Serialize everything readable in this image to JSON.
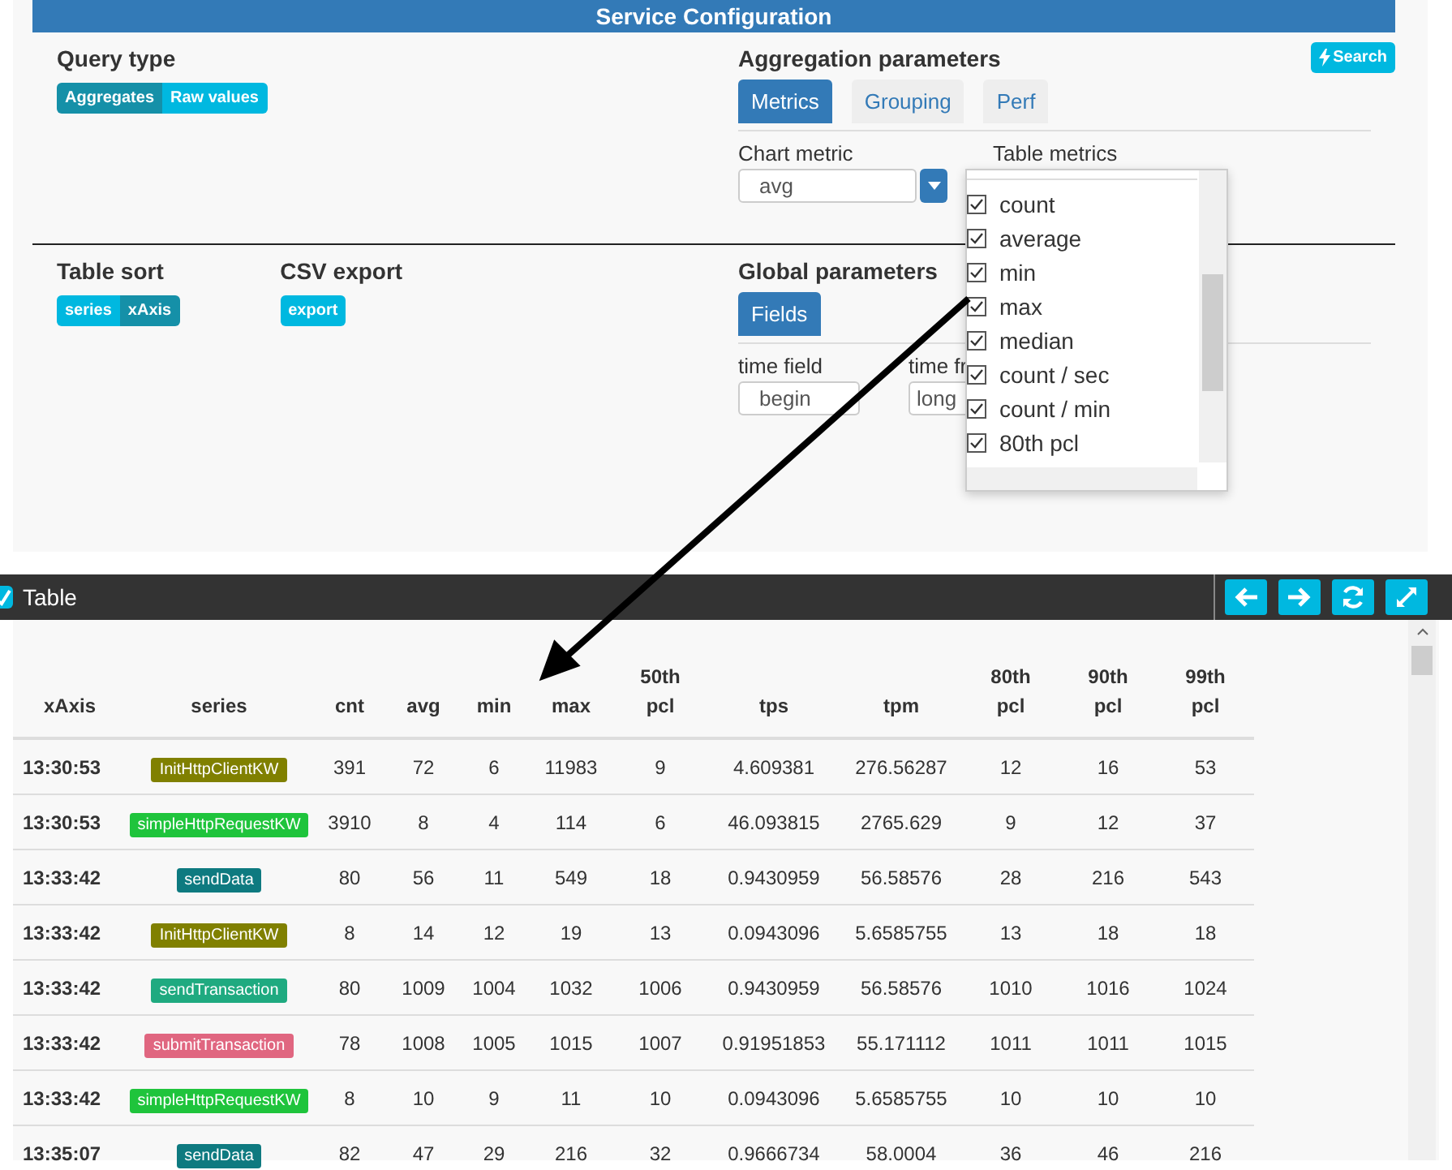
{
  "config": {
    "title": "Service Configuration",
    "query_type": {
      "label": "Query type",
      "options": [
        {
          "label": "Aggregates",
          "selected": true
        },
        {
          "label": "Raw values",
          "selected": false
        }
      ]
    },
    "aggregation": {
      "label": "Aggregation parameters",
      "search_button": "Search",
      "tabs": [
        {
          "label": "Metrics",
          "selected": true
        },
        {
          "label": "Grouping",
          "selected": false
        },
        {
          "label": "Perf",
          "selected": false
        }
      ],
      "chart_metric": {
        "label": "Chart metric",
        "value": "avg"
      },
      "table_metrics": {
        "label": "Table metrics",
        "options": [
          {
            "label": "count",
            "checked": true
          },
          {
            "label": "average",
            "checked": true
          },
          {
            "label": "min",
            "checked": true
          },
          {
            "label": "max",
            "checked": true
          },
          {
            "label": "median",
            "checked": true
          },
          {
            "label": "count / sec",
            "checked": true
          },
          {
            "label": "count / min",
            "checked": true
          },
          {
            "label": "80th pcl",
            "checked": true
          }
        ]
      }
    },
    "table_sort": {
      "label": "Table sort",
      "options": [
        {
          "label": "series",
          "selected": false
        },
        {
          "label": "xAxis",
          "selected": true
        }
      ]
    },
    "csv_export": {
      "label": "CSV export",
      "button": "export"
    },
    "global": {
      "label": "Global parameters",
      "tabs": [
        {
          "label": "Fields",
          "selected": true
        }
      ],
      "fields": [
        {
          "label": "time field",
          "value": "begin"
        },
        {
          "label": "time fr",
          "value": "long"
        }
      ]
    }
  },
  "table_panel": {
    "title": "Table",
    "columns": [
      "xAxis",
      "series",
      "cnt",
      "avg",
      "min",
      "max",
      "50th pcl",
      "tps",
      "tpm",
      "80th pcl",
      "90th pcl",
      "99th pcl"
    ],
    "rows": [
      {
        "xAxis": "13:30:53",
        "series": "InitHttpClientKW",
        "color": "#808000",
        "values": [
          "391",
          "72",
          "6",
          "11983",
          "9",
          "4.609381",
          "276.56287",
          "12",
          "16",
          "53"
        ]
      },
      {
        "xAxis": "13:30:53",
        "series": "simpleHttpRequestKW",
        "color": "#1fc43c",
        "values": [
          "3910",
          "8",
          "4",
          "114",
          "6",
          "46.093815",
          "2765.629",
          "9",
          "12",
          "37"
        ]
      },
      {
        "xAxis": "13:33:42",
        "series": "sendData",
        "color": "#0e7a80",
        "values": [
          "80",
          "56",
          "11",
          "549",
          "18",
          "0.9430959",
          "56.58576",
          "28",
          "216",
          "543"
        ]
      },
      {
        "xAxis": "13:33:42",
        "series": "InitHttpClientKW",
        "color": "#808000",
        "values": [
          "8",
          "14",
          "12",
          "19",
          "13",
          "0.0943096",
          "5.6585755",
          "13",
          "18",
          "18"
        ]
      },
      {
        "xAxis": "13:33:42",
        "series": "sendTransaction",
        "color": "#1faa80",
        "values": [
          "80",
          "1009",
          "1004",
          "1032",
          "1006",
          "0.9430959",
          "56.58576",
          "1010",
          "1016",
          "1024"
        ]
      },
      {
        "xAxis": "13:33:42",
        "series": "submitTransaction",
        "color": "#e06680",
        "values": [
          "78",
          "1008",
          "1005",
          "1015",
          "1007",
          "0.91951853",
          "55.171112",
          "1011",
          "1011",
          "1015"
        ]
      },
      {
        "xAxis": "13:33:42",
        "series": "simpleHttpRequestKW",
        "color": "#1fc43c",
        "values": [
          "8",
          "10",
          "9",
          "11",
          "10",
          "0.0943096",
          "5.6585755",
          "10",
          "10",
          "10"
        ]
      },
      {
        "xAxis": "13:35:07",
        "series": "sendData",
        "color": "#0e7a80",
        "values": [
          "82",
          "47",
          "29",
          "216",
          "32",
          "0.9666734",
          "58.0004",
          "36",
          "46",
          "216"
        ]
      }
    ]
  }
}
